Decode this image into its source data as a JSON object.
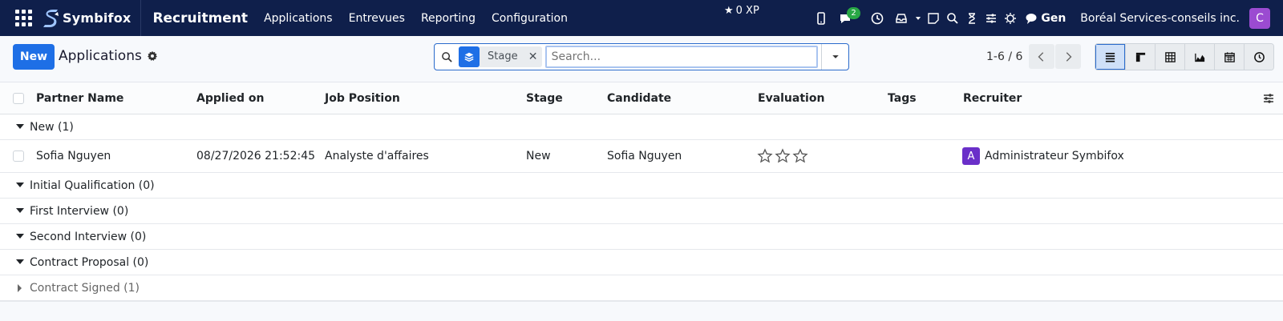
{
  "navbar": {
    "brand": "Symbifox",
    "app_name": "Recruitment",
    "menu": [
      "Applications",
      "Entrevues",
      "Reporting",
      "Configuration"
    ],
    "xp": "0 XP",
    "chat_badge": "2",
    "gen_label": "Gen",
    "company": "Boréal Services-conseils inc.",
    "user_initial": "C",
    "colors": {
      "bg": "#0f1f4b",
      "avatar": "#9b4bd1",
      "badge": "#28a745"
    }
  },
  "control": {
    "new_label": "New",
    "title": "Applications",
    "facet_label": "Stage",
    "search_placeholder": "Search...",
    "pager": "1-6 / 6"
  },
  "list": {
    "columns": [
      "Partner Name",
      "Applied on",
      "Job Position",
      "Stage",
      "Candidate",
      "Evaluation",
      "Tags",
      "Recruiter"
    ],
    "groups": [
      {
        "label": "New (1)",
        "open": true,
        "rows": [
          {
            "partner": "Sofia Nguyen",
            "applied_on": "08/27/2026 21:52:45",
            "job": "Analyste d'affaires",
            "stage": "New",
            "candidate": "Sofia Nguyen",
            "evaluation": 0,
            "tags": "",
            "recruiter_initial": "A",
            "recruiter": "Administrateur Symbifox"
          }
        ]
      },
      {
        "label": "Initial Qualification (0)",
        "open": true,
        "rows": []
      },
      {
        "label": "First Interview (0)",
        "open": true,
        "rows": []
      },
      {
        "label": "Second Interview (0)",
        "open": true,
        "rows": []
      },
      {
        "label": "Contract Proposal (0)",
        "open": true,
        "rows": []
      },
      {
        "label": "Contract Signed (1)",
        "open": false,
        "rows": []
      }
    ]
  }
}
